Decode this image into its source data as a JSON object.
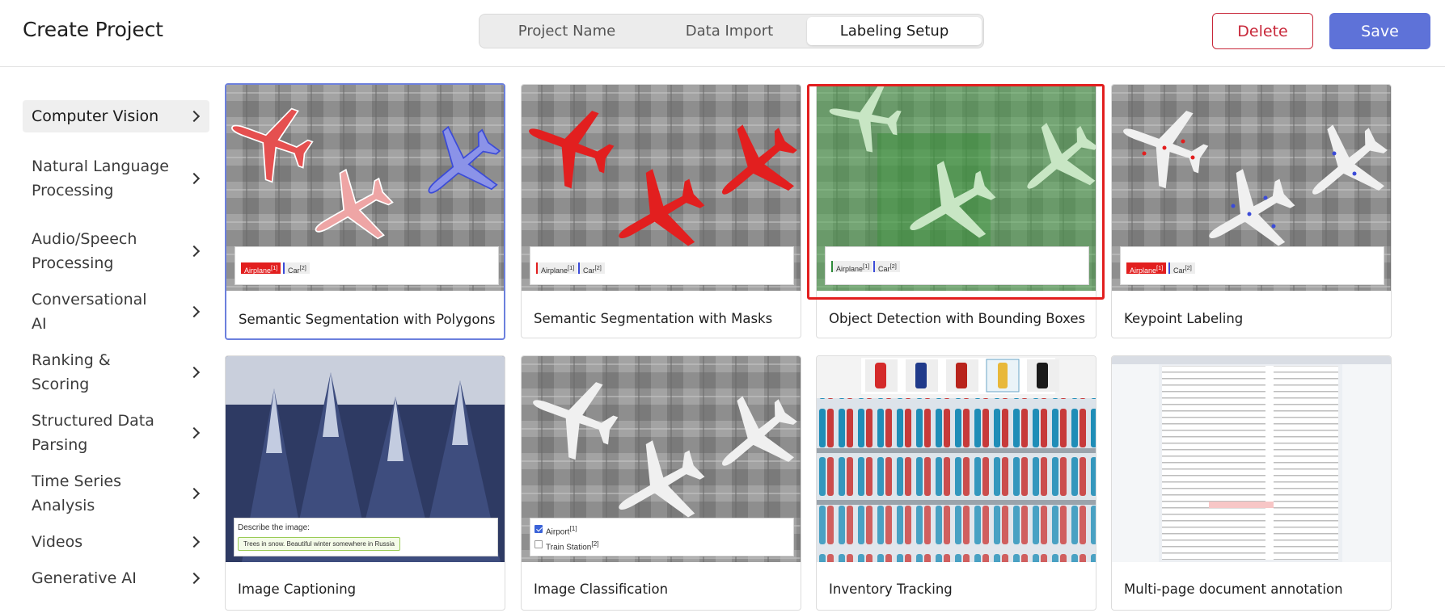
{
  "header": {
    "title": "Create Project",
    "tabs": [
      {
        "label": "Project Name"
      },
      {
        "label": "Data Import"
      },
      {
        "label": "Labeling Setup",
        "active": true
      }
    ],
    "delete_label": "Delete",
    "save_label": "Save"
  },
  "colors": {
    "accent": "#5e72d8",
    "danger": "#c8283a",
    "highlight": "#e21f1f"
  },
  "sidebar": {
    "items": [
      {
        "label": "Computer Vision",
        "active": true
      },
      {
        "label": "Natural Language Processing"
      },
      {
        "label": "Audio/Speech Processing"
      },
      {
        "label": "Conversational AI"
      },
      {
        "label": "Ranking & Scoring"
      },
      {
        "label": "Structured Data Parsing"
      },
      {
        "label": "Time Series Analysis"
      },
      {
        "label": "Videos"
      },
      {
        "label": "Generative AI"
      }
    ]
  },
  "templates": [
    {
      "title": "Semantic Segmentation with Polygons",
      "selected": true,
      "tags": [
        "Airplane",
        "Car"
      ]
    },
    {
      "title": "Semantic Segmentation with Masks",
      "tags": [
        "Airplane",
        "Car"
      ]
    },
    {
      "title": "Object Detection with Bounding Boxes",
      "highlighted": true,
      "tags": [
        "Airplane",
        "Car"
      ]
    },
    {
      "title": "Keypoint Labeling",
      "tags": [
        "Airplane",
        "Car"
      ]
    },
    {
      "title": "Image Captioning",
      "prompt": "Describe the image:",
      "caption": "Trees in snow. Beautiful winter somewhere in Russia"
    },
    {
      "title": "Image Classification",
      "choices": [
        "Airport",
        "Train Station"
      ]
    },
    {
      "title": "Inventory Tracking"
    },
    {
      "title": "Multi-page document annotation"
    }
  ],
  "tag_indices": {
    "one": "[1]",
    "two": "[2]"
  }
}
